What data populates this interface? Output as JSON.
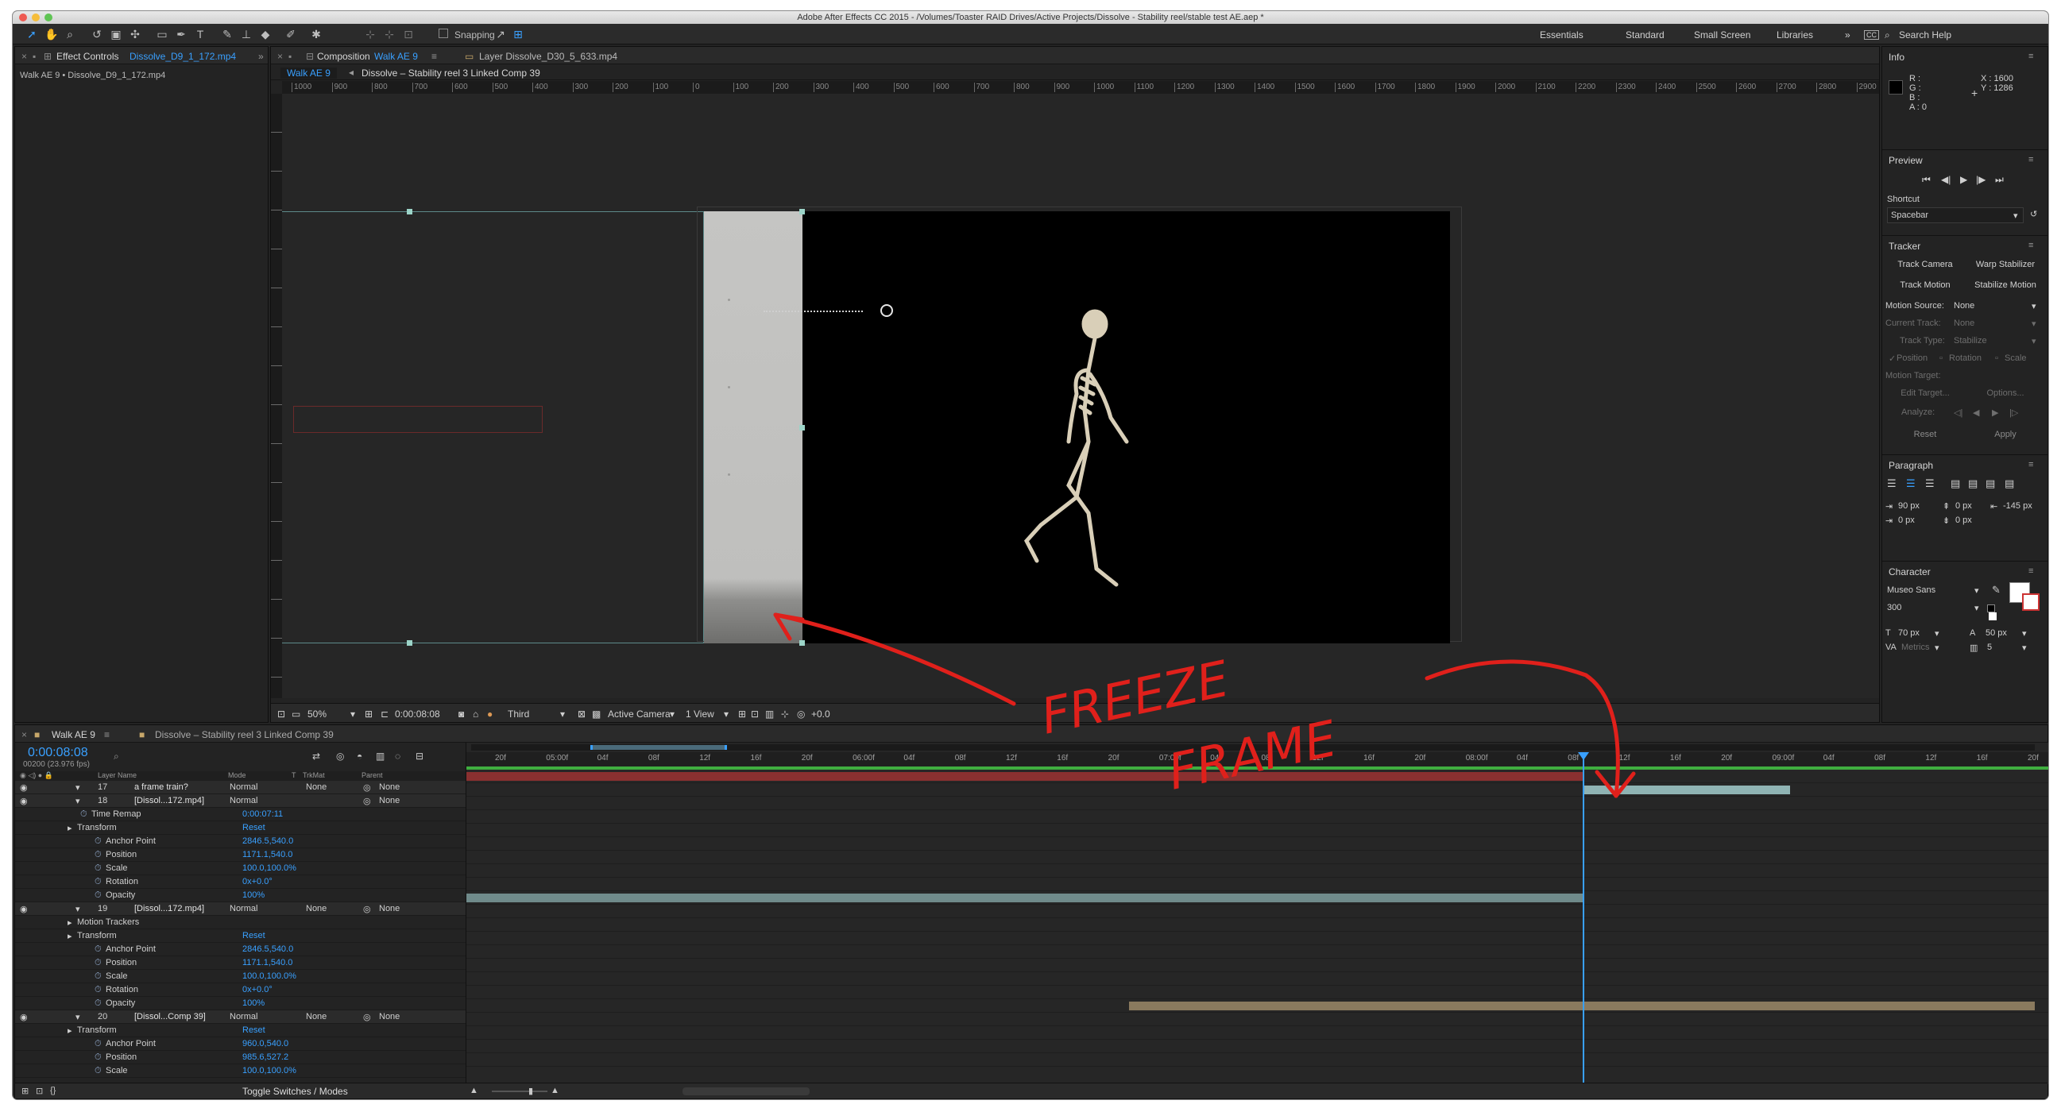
{
  "app": {
    "title": "Adobe After Effects CC 2015 - /Volumes/Toaster RAID Drives/Active Projects/Dissolve - Stability reel/stable test AE.aep *",
    "snapping_label": "Snapping",
    "workspaces": [
      "Essentials",
      "Standard",
      "Small Screen",
      "Libraries"
    ],
    "search_placeholder": "Search Help"
  },
  "effect_controls": {
    "tab_prefix": "Effect Controls",
    "tab_layer": "Dissolve_D9_1_172.mp4",
    "breadcrumb": "Walk AE 9 • Dissolve_D9_1_172.mp4"
  },
  "composition": {
    "tab_prefix": "Composition",
    "tab_name": "Walk AE 9",
    "layer_tab": "Layer Dissolve_D30_5_633.mp4",
    "flow_current": "Walk AE 9",
    "flow_next": "Dissolve – Stability reel 3 Linked Comp 39",
    "ruler_labels": [
      "1000",
      "900",
      "800",
      "700",
      "600",
      "500",
      "400",
      "300",
      "200",
      "100",
      "0",
      "100",
      "200",
      "300",
      "400",
      "500",
      "600",
      "700",
      "800",
      "900",
      "1000",
      "1100",
      "1200",
      "1300",
      "1400",
      "1500",
      "1600",
      "1700",
      "1800",
      "1900",
      "2000",
      "2100",
      "2200",
      "2300",
      "2400",
      "2500",
      "2600",
      "2700",
      "2800",
      "2900"
    ],
    "footer": {
      "zoom": "50%",
      "timecode": "0:00:08:08",
      "resolution": "Third",
      "camera": "Active Camera",
      "views": "1 View",
      "exposure": "+0.0"
    }
  },
  "annotation": {
    "text_line1": "FREEZE",
    "text_line2": "FRAME",
    "color": "#e0201b"
  },
  "info": {
    "title": "Info",
    "r": "R :",
    "g": "G :",
    "b": "B :",
    "a": "A : 0",
    "x": "X : 1600",
    "y": "Y : 1286"
  },
  "preview": {
    "title": "Preview",
    "shortcut_label": "Shortcut",
    "shortcut_value": "Spacebar"
  },
  "tracker": {
    "title": "Tracker",
    "track_camera": "Track Camera",
    "warp_stabilizer": "Warp Stabilizer",
    "track_motion": "Track Motion",
    "stabilize_motion": "Stabilize Motion",
    "motion_source_label": "Motion Source:",
    "motion_source_value": "None",
    "current_track_label": "Current Track:",
    "current_track_value": "None",
    "track_type_label": "Track Type:",
    "track_type_value": "Stabilize",
    "position": "Position",
    "rotation": "Rotation",
    "scale": "Scale",
    "motion_target_label": "Motion Target:",
    "edit_target": "Edit Target...",
    "options": "Options...",
    "analyze": "Analyze:",
    "reset": "Reset",
    "apply": "Apply"
  },
  "paragraph": {
    "title": "Paragraph",
    "indent_left": "90 px",
    "space_before": "0 px",
    "indent_right": "-145 px",
    "first_line": "0 px",
    "space_after": "0 px"
  },
  "character": {
    "title": "Character",
    "font": "Museo Sans",
    "style": "300",
    "size": "70 px",
    "leading": "50 px",
    "kerning": "Metrics",
    "tracking": "5"
  },
  "timeline": {
    "tab_active": "Walk AE 9",
    "tab_other": "Dissolve – Stability reel 3 Linked Comp 39",
    "timecode": "0:00:08:08",
    "frame_info": "00200 (23.976 fps)",
    "columns": {
      "layer_name": "Layer Name",
      "mode": "Mode",
      "t": "T",
      "trkmat": "TrkMat",
      "parent": "Parent"
    },
    "toggle_label": "Toggle Switches / Modes",
    "time_labels": [
      "20f",
      "05:00f",
      "04f",
      "08f",
      "12f",
      "16f",
      "20f",
      "06:00f",
      "04f",
      "08f",
      "12f",
      "16f",
      "20f",
      "07:00f",
      "04f",
      "08f",
      "12f",
      "16f",
      "20f",
      "08:00f",
      "04f",
      "08f",
      "12f",
      "16f",
      "20f",
      "09:00f",
      "04f",
      "08f",
      "12f",
      "16f",
      "20f"
    ],
    "rows": [
      {
        "kind": "layer",
        "num": "17",
        "name": "a frame train?",
        "mode": "Normal",
        "trk": "None",
        "parent": "None"
      },
      {
        "kind": "layer",
        "num": "18",
        "name": "[Dissol...172.mp4]",
        "mode": "Normal",
        "trk": "",
        "parent": "None"
      },
      {
        "kind": "prop",
        "indent": 2,
        "name": "Time Remap",
        "value": "0:00:07:11"
      },
      {
        "kind": "group",
        "indent": 1,
        "name": "Transform",
        "value": "Reset"
      },
      {
        "kind": "prop",
        "indent": 3,
        "name": "Anchor Point",
        "value": "2846.5,540.0"
      },
      {
        "kind": "prop",
        "indent": 3,
        "name": "Position",
        "value": "1171.1,540.0"
      },
      {
        "kind": "prop",
        "indent": 3,
        "name": "Scale",
        "value": "100.0,100.0%"
      },
      {
        "kind": "prop",
        "indent": 3,
        "name": "Rotation",
        "value": "0x+0.0°"
      },
      {
        "kind": "prop",
        "indent": 3,
        "name": "Opacity",
        "value": "100%"
      },
      {
        "kind": "layer",
        "num": "19",
        "name": "[Dissol...172.mp4]",
        "mode": "Normal",
        "trk": "None",
        "parent": "None"
      },
      {
        "kind": "group",
        "indent": 1,
        "name": "Motion Trackers",
        "value": ""
      },
      {
        "kind": "group",
        "indent": 1,
        "name": "Transform",
        "value": "Reset"
      },
      {
        "kind": "prop",
        "indent": 3,
        "name": "Anchor Point",
        "value": "2846.5,540.0"
      },
      {
        "kind": "prop",
        "indent": 3,
        "name": "Position",
        "value": "1171.1,540.0"
      },
      {
        "kind": "prop",
        "indent": 3,
        "name": "Scale",
        "value": "100.0,100.0%"
      },
      {
        "kind": "prop",
        "indent": 3,
        "name": "Rotation",
        "value": "0x+0.0°"
      },
      {
        "kind": "prop",
        "indent": 3,
        "name": "Opacity",
        "value": "100%"
      },
      {
        "kind": "layer",
        "num": "20",
        "name": "[Dissol...Comp 39]",
        "mode": "Normal",
        "trk": "None",
        "parent": "None"
      },
      {
        "kind": "group",
        "indent": 1,
        "name": "Transform",
        "value": "Reset"
      },
      {
        "kind": "prop",
        "indent": 3,
        "name": "Anchor Point",
        "value": "960.0,540.0"
      },
      {
        "kind": "prop",
        "indent": 3,
        "name": "Position",
        "value": "985.6,527.2"
      },
      {
        "kind": "prop",
        "indent": 3,
        "name": "Scale",
        "value": "100.0,100.0%"
      }
    ]
  }
}
